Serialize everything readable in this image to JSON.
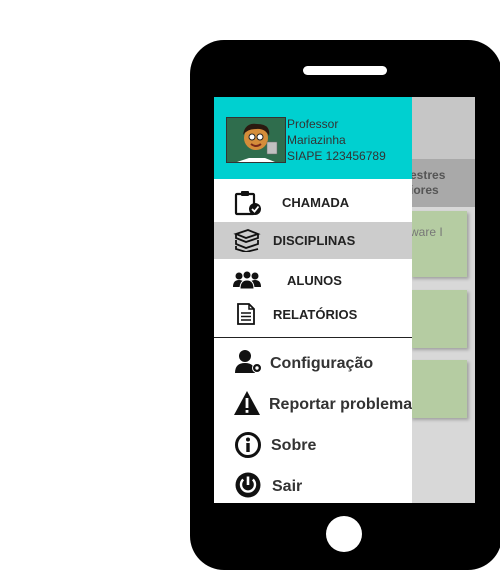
{
  "background": {
    "tab_text_line1": "estres",
    "tab_text_line2": "iores",
    "card_text": "ware I"
  },
  "profile": {
    "role": "Professor",
    "name": "Mariazinha",
    "siape": "SIAPE 123456789"
  },
  "menu": {
    "primary": [
      {
        "label": "CHAMADA",
        "icon": "clipboard-check-icon"
      },
      {
        "label": "DISCIPLINAS",
        "icon": "books-icon"
      },
      {
        "label": "ALUNOS",
        "icon": "group-users-icon"
      },
      {
        "label": "RELATÓRIOS",
        "icon": "document-icon"
      }
    ],
    "secondary": [
      {
        "label": "Configuração",
        "icon": "user-settings-icon"
      },
      {
        "label": "Reportar problema",
        "icon": "warning-icon"
      },
      {
        "label": "Sobre",
        "icon": "info-icon"
      },
      {
        "label": "Sair",
        "icon": "power-icon"
      }
    ]
  },
  "colors": {
    "header": "#00d0d0",
    "selected": "#cccccc",
    "card": "#b5cca2"
  }
}
